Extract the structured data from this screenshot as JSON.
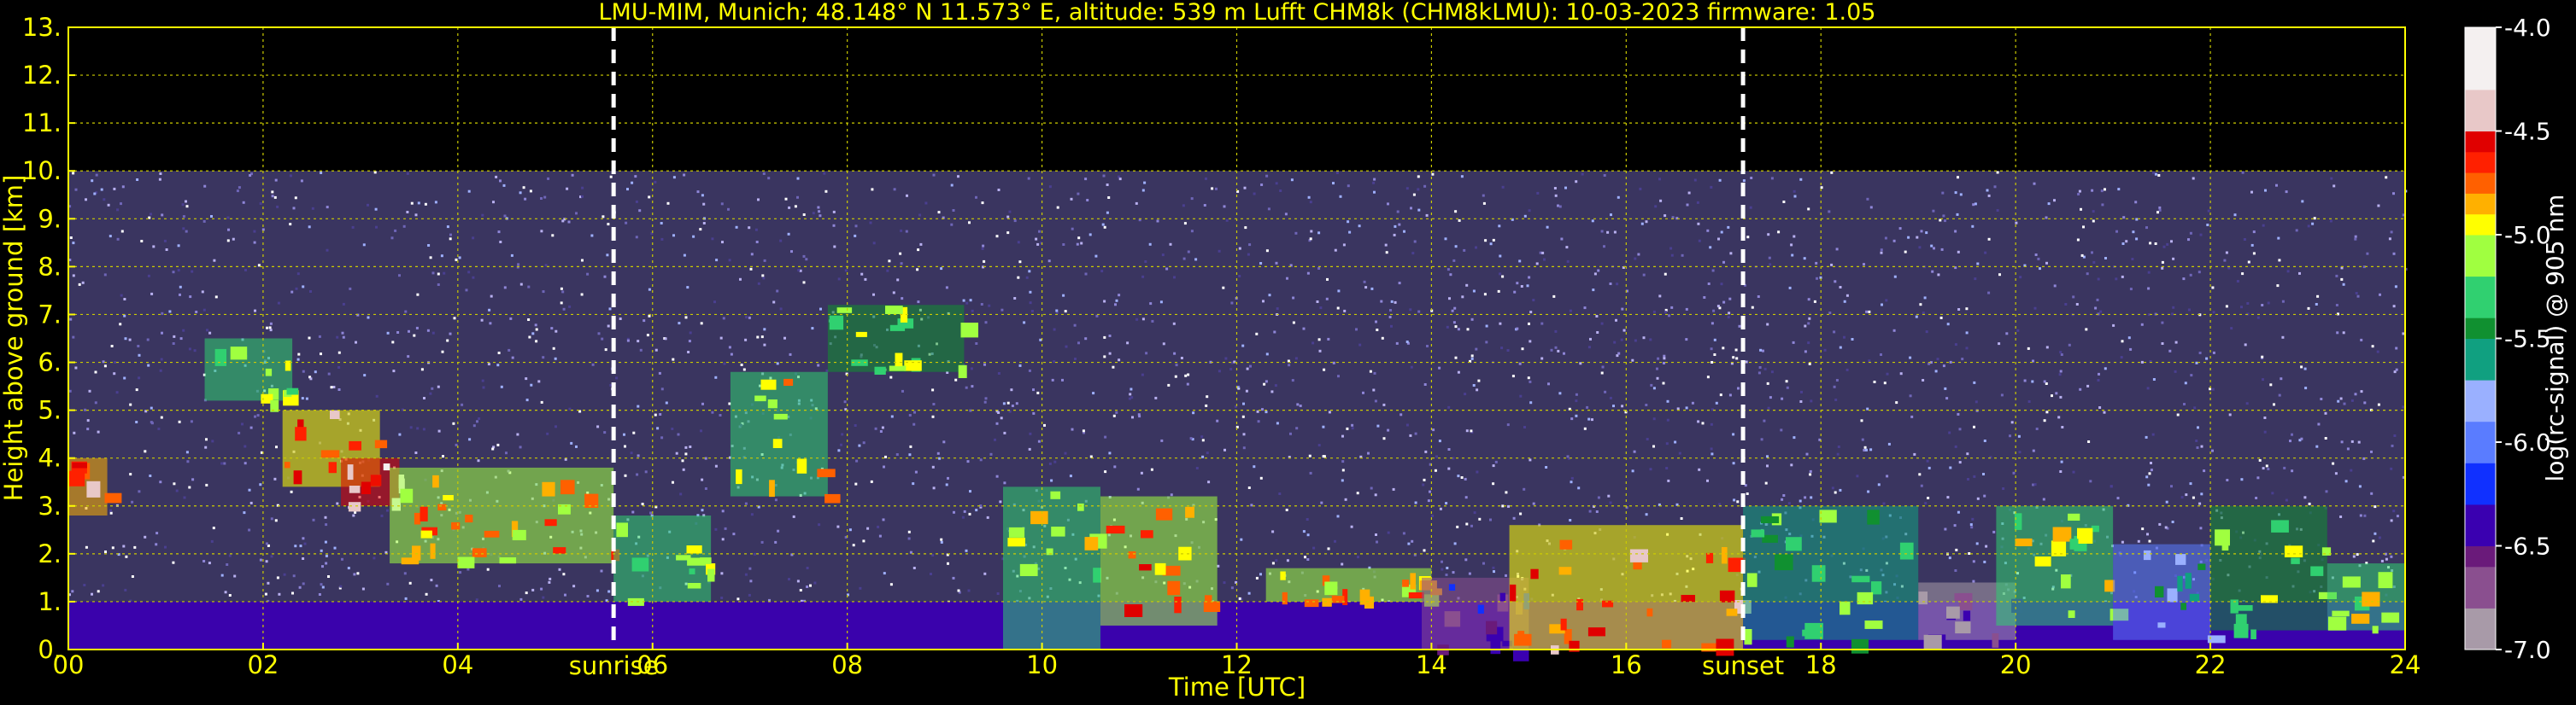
{
  "chart_data": {
    "type": "heatmap",
    "title": "LMU-MIM, Munich; 48.148° N 11.573° E, altitude: 539 m    Lufft CHM8k (CHM8kLMU): 10-03-2023    firmware: 1.05",
    "xlabel": "Time [UTC]",
    "ylabel": "Height above ground [km]",
    "xlim": [
      0,
      24
    ],
    "ylim": [
      0,
      13
    ],
    "x_ticks": [
      "00",
      "02",
      "04",
      "06",
      "08",
      "10",
      "12",
      "14",
      "16",
      "18",
      "20",
      "22",
      "24"
    ],
    "y_ticks": [
      "0.",
      "1.",
      "2.",
      "3.",
      "4.",
      "5.",
      "6.",
      "7.",
      "8.",
      "9.",
      "10.",
      "11.",
      "12.",
      "13."
    ],
    "grid": true,
    "colorbar": {
      "label": "log(rc-signal) @ 905 nm",
      "range": [
        -7.0,
        -4.0
      ],
      "ticks": [
        "-4.0",
        "-4.5",
        "-5.0",
        "-5.5",
        "-6.0",
        "-6.5",
        "-7.0"
      ]
    },
    "markers": [
      {
        "label": "sunrise",
        "x": 5.6
      },
      {
        "label": "sunset",
        "x": 17.2
      }
    ],
    "noise_top_km": 10,
    "features": [
      {
        "name": "aerosol-layer",
        "t0": 0.0,
        "t1": 24.0,
        "h0": 0.0,
        "h1": 1.0,
        "level": -6.4
      },
      {
        "name": "cloud",
        "t0": 0.0,
        "t1": 0.4,
        "h0": 2.8,
        "h1": 4.0,
        "level": -4.3
      },
      {
        "name": "cloud",
        "t0": 1.4,
        "t1": 2.3,
        "h0": 5.2,
        "h1": 6.5,
        "level": -4.8
      },
      {
        "name": "cloud",
        "t0": 2.2,
        "t1": 3.2,
        "h0": 3.4,
        "h1": 5.0,
        "level": -4.4
      },
      {
        "name": "cloud",
        "t0": 2.8,
        "t1": 3.4,
        "h0": 3.0,
        "h1": 4.0,
        "level": -4.0
      },
      {
        "name": "cloud",
        "t0": 3.3,
        "t1": 5.6,
        "h0": 1.8,
        "h1": 3.8,
        "level": -4.6
      },
      {
        "name": "cloud",
        "t0": 5.6,
        "t1": 6.6,
        "h0": 1.0,
        "h1": 2.8,
        "level": -4.8
      },
      {
        "name": "cloud",
        "t0": 6.8,
        "t1": 7.8,
        "h0": 3.2,
        "h1": 5.8,
        "level": -4.7
      },
      {
        "name": "cloud",
        "t0": 7.8,
        "t1": 9.2,
        "h0": 5.8,
        "h1": 7.2,
        "level": -4.9
      },
      {
        "name": "cloud",
        "t0": 9.6,
        "t1": 10.6,
        "h0": 0.0,
        "h1": 3.4,
        "level": -4.8
      },
      {
        "name": "cloud",
        "t0": 10.6,
        "t1": 11.8,
        "h0": 0.5,
        "h1": 3.2,
        "level": -4.5
      },
      {
        "name": "cloud",
        "t0": 12.3,
        "t1": 14.0,
        "h0": 1.0,
        "h1": 1.7,
        "level": -4.6
      },
      {
        "name": "cloud",
        "t0": 13.9,
        "t1": 15.0,
        "h0": 0.0,
        "h1": 1.5,
        "level": -6.2
      },
      {
        "name": "cloud",
        "t0": 14.8,
        "t1": 17.2,
        "h0": 0.0,
        "h1": 2.6,
        "level": -4.4
      },
      {
        "name": "cloud",
        "t0": 17.2,
        "t1": 19.0,
        "h0": 0.2,
        "h1": 3.0,
        "level": -5.0
      },
      {
        "name": "cloud",
        "t0": 19.0,
        "t1": 20.0,
        "h0": 0.2,
        "h1": 1.4,
        "level": -6.4
      },
      {
        "name": "cloud",
        "t0": 19.8,
        "t1": 21.0,
        "h0": 0.5,
        "h1": 3.0,
        "level": -4.8
      },
      {
        "name": "cloud",
        "t0": 21.0,
        "t1": 22.0,
        "h0": 0.2,
        "h1": 2.2,
        "level": -5.4
      },
      {
        "name": "cloud",
        "t0": 22.0,
        "t1": 23.2,
        "h0": 0.4,
        "h1": 3.0,
        "level": -4.9
      },
      {
        "name": "cloud",
        "t0": 23.2,
        "t1": 24.0,
        "h0": 0.4,
        "h1": 1.8,
        "level": -4.8
      }
    ]
  }
}
